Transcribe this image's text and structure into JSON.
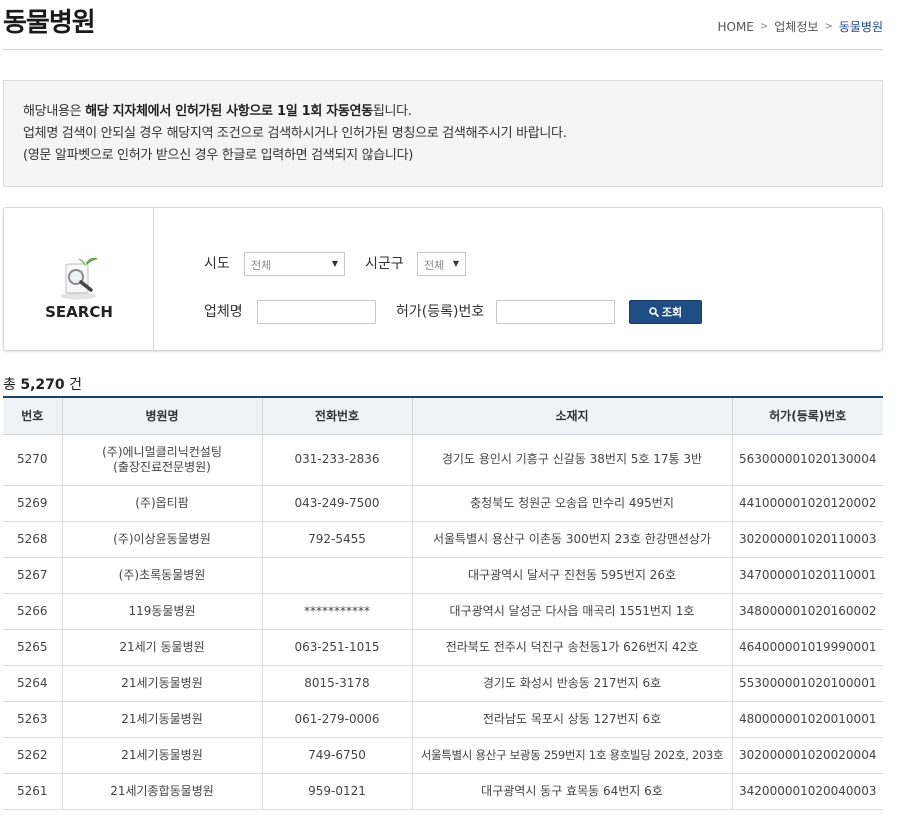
{
  "header": {
    "title": "동물병원",
    "breadcrumb": [
      "HOME",
      "업체정보",
      "동물병원"
    ]
  },
  "notice": {
    "line1_prefix": "해당내용은 ",
    "line1_bold": "해당 지자체에서 인허가된 사항으로 1일 1회 자동연동",
    "line1_suffix": "됩니다.",
    "line2": "업체명 검색이 안되실 경우 해당지역 조건으로 검색하시거나 인허가된 명칭으로 검색해주시기 바랍니다.",
    "line3": "(영문 알파벳으로 인허가 받으신 경우 한글로 입력하면 검색되지 않습니다)"
  },
  "search": {
    "label": "SEARCH",
    "sido_label": "시도",
    "sido_value": "전체",
    "sigungu_label": "시군구",
    "sigungu_value": "전체",
    "company_label": "업체명",
    "company_value": "",
    "license_label": "허가(등록)번호",
    "license_value": "",
    "button_label": "조회"
  },
  "results": {
    "total_prefix": "총 ",
    "total_count": "5,270",
    "total_suffix": " 건",
    "columns": [
      "번호",
      "병원명",
      "전화번호",
      "소재지",
      "허가(등록)번호"
    ],
    "rows": [
      {
        "no": "5270",
        "name": "(주)에니멀클리닉컨설팅",
        "name2": "(출장진료전문병원)",
        "phone": "031-233-2836",
        "address": "경기도 용인시 기흥구 신갈동 38번지 5호 17통 3반",
        "license": "563000001020130004"
      },
      {
        "no": "5269",
        "name": "(주)옵티팜",
        "name2": "",
        "phone": "043-249-7500",
        "address": "충청북도 청원군 오송읍 만수리 495번지",
        "license": "441000001020120002"
      },
      {
        "no": "5268",
        "name": "(주)이상윤동물병원",
        "name2": "",
        "phone": "792-5455",
        "address": "서울특별시 용산구 이촌동 300번지 23호 한강맨션상가",
        "license": "302000001020110003"
      },
      {
        "no": "5267",
        "name": "(주)초록동물병원",
        "name2": "",
        "phone": "",
        "address": "대구광역시 달서구 진천동 595번지 26호",
        "license": "347000001020110001"
      },
      {
        "no": "5266",
        "name": "119동물병원",
        "name2": "",
        "phone": "***********",
        "address": "대구광역시 달성군 다사읍 매곡리 1551번지 1호",
        "license": "348000001020160002"
      },
      {
        "no": "5265",
        "name": "21세기 동물병원",
        "name2": "",
        "phone": "063-251-1015",
        "address": "전라북도 전주시 덕진구 송천동1가 626번지 42호",
        "license": "464000001019990001"
      },
      {
        "no": "5264",
        "name": "21세기동물병원",
        "name2": "",
        "phone": "8015-3178",
        "address": "경기도 화성시 반송동 217번지 6호",
        "license": "553000001020100001"
      },
      {
        "no": "5263",
        "name": "21세기동물병원",
        "name2": "",
        "phone": "061-279-0006",
        "address": "전라남도 목포시 상동 127번지 6호",
        "license": "480000001020010001"
      },
      {
        "no": "5262",
        "name": "21세기동물병원",
        "name2": "",
        "phone": "749-6750",
        "address": "서울특별시 용산구 보광동 259번지 1호 용호빌딩 202호, 203호",
        "license": "302000001020020004"
      },
      {
        "no": "5261",
        "name": "21세기종합동물병원",
        "name2": "",
        "phone": "959-0121",
        "address": "대구광역시 동구 효목동 64번지 6호",
        "license": "342000001020040003"
      }
    ]
  }
}
